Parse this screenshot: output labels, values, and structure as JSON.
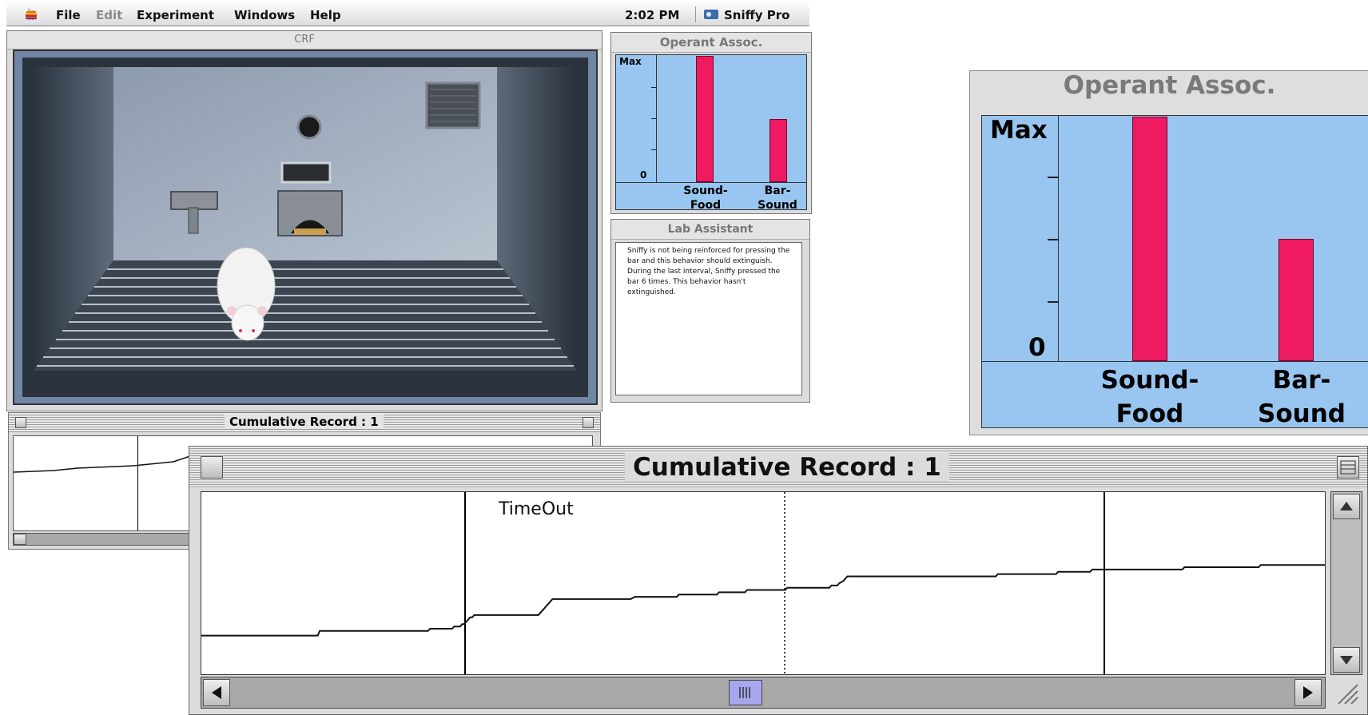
{
  "menubar": {
    "items": [
      {
        "label": "File",
        "enabled": true
      },
      {
        "label": "Edit",
        "enabled": false
      },
      {
        "label": "Experiment",
        "enabled": true
      },
      {
        "label": "Windows",
        "enabled": true
      },
      {
        "label": "Help",
        "enabled": true
      }
    ],
    "clock": "2:02 PM",
    "app_name": "Sniffy Pro"
  },
  "chamber_window": {
    "title": "CRF"
  },
  "operant_small": {
    "title": "Operant Assoc.",
    "y_max_label": "Max",
    "y_min_label": "0",
    "categories": [
      "Sound-\nFood",
      "Bar-\nSound"
    ],
    "cat1_line1": "Sound-",
    "cat1_line2": "Food",
    "cat2_line1": "Bar-",
    "cat2_line2": "Sound"
  },
  "lab_assistant": {
    "title": "Lab Assistant",
    "message": "Sniffy is not being reinforced for pressing the bar and this behavior should extinguish. During the last interval, Sniffy pressed the bar 6 times. This behavior hasn't extinguished."
  },
  "cumulative_small": {
    "title": "Cumulative Record : 1"
  },
  "operant_large": {
    "title": "Operant Assoc.",
    "y_max_label": "Max",
    "y_min_label": "0",
    "cat1_line1": "Sound-",
    "cat1_line2": "Food",
    "cat2_line1": "Bar-",
    "cat2_line2": "Sound"
  },
  "cumulative_large": {
    "title": "Cumulative Record : 1",
    "annotation": "TimeOut"
  },
  "chart_data": [
    {
      "type": "bar",
      "title": "Operant Assoc.",
      "categories": [
        "Sound-Food",
        "Bar-Sound"
      ],
      "values": [
        1.0,
        0.5
      ],
      "y_labels": [
        "0",
        "Max"
      ],
      "ylim": [
        0,
        1
      ],
      "colors": {
        "bar": "#ee1a62",
        "background": "#98c6f0"
      }
    },
    {
      "type": "line",
      "title": "Cumulative Record : 1",
      "annotation": "TimeOut",
      "series": [
        {
          "values": [
            [
              0,
              17
            ],
            [
              58,
              17
            ],
            [
              59,
              19
            ],
            [
              113,
              19
            ],
            [
              114,
              20
            ],
            [
              125,
              20
            ],
            [
              126,
              21
            ],
            [
              129,
              21
            ],
            [
              130,
              22
            ],
            [
              131,
              22
            ],
            [
              132,
              23
            ],
            [
              133,
              24
            ],
            [
              134,
              25
            ],
            [
              135,
              25
            ],
            [
              136,
              26
            ],
            [
              168,
              26
            ],
            [
              169,
              27
            ],
            [
              170,
              28
            ],
            [
              171,
              29
            ],
            [
              172,
              30
            ],
            [
              173,
              31
            ],
            [
              174,
              32
            ],
            [
              175,
              33
            ],
            [
              214,
              33
            ],
            [
              216,
              34
            ],
            [
              237,
              34
            ],
            [
              238,
              35
            ],
            [
              257,
              35
            ],
            [
              258,
              36
            ],
            [
              271,
              36
            ],
            [
              272,
              37
            ],
            [
              291,
              37
            ],
            [
              292,
              38
            ],
            [
              313,
              38
            ],
            [
              314,
              39
            ],
            [
              317,
              39
            ],
            [
              318,
              40
            ],
            [
              320,
              41
            ],
            [
              321,
              42
            ],
            [
              322,
              43
            ],
            [
              396,
              43
            ],
            [
              397,
              44
            ],
            [
              426,
              44
            ],
            [
              427,
              45
            ],
            [
              443,
              45
            ],
            [
              444,
              46
            ],
            [
              489,
              46
            ],
            [
              490,
              47
            ],
            [
              527,
              47
            ],
            [
              528,
              48
            ],
            [
              560,
              48
            ]
          ]
        }
      ],
      "xlim": [
        0,
        560
      ],
      "ylim": [
        0,
        80
      ],
      "colors": {
        "line": "#111111"
      }
    }
  ]
}
